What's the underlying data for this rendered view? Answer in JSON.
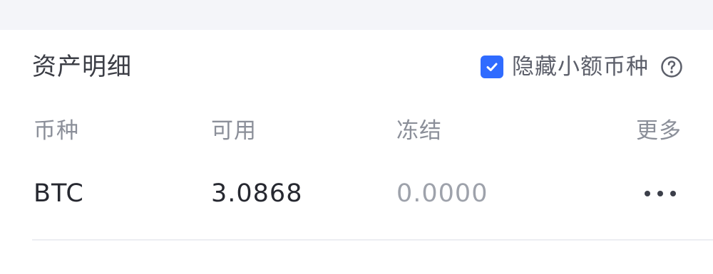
{
  "section": {
    "title": "资产明细",
    "hide_small_label": "隐藏小额币种",
    "hide_small_checked": true,
    "help_icon": "question-circle-icon"
  },
  "table": {
    "headers": [
      "币种",
      "可用",
      "冻结",
      "更多"
    ],
    "rows": [
      {
        "coin": "BTC",
        "available": "3.0868",
        "frozen": "0.0000",
        "more_icon": "ellipsis-icon"
      }
    ]
  },
  "colors": {
    "accent": "#2f6bff",
    "text_primary": "#262830",
    "text_secondary": "#8b8f99",
    "text_muted": "#9ea2ab"
  }
}
